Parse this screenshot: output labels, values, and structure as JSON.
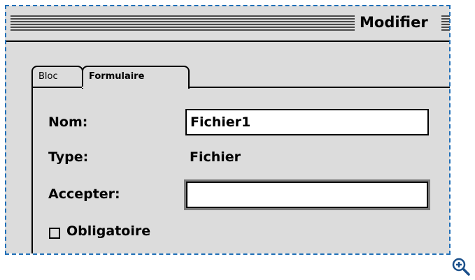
{
  "window": {
    "title": "Modifier"
  },
  "tabs": [
    {
      "label": "Bloc",
      "selected": false
    },
    {
      "label": "Formulaire",
      "selected": true
    }
  ],
  "form": {
    "name_label": "Nom:",
    "name_value": "Fichier1",
    "type_label": "Type:",
    "type_value": "Fichier",
    "accept_label": "Accepter:",
    "accept_value": "",
    "required_label": "Obligatoire",
    "required_checked": false
  },
  "colors": {
    "selection_border": "#1f6fb8",
    "window_bg": "#dcdcdc"
  },
  "icons": {
    "zoom": "zoom-in-icon"
  }
}
